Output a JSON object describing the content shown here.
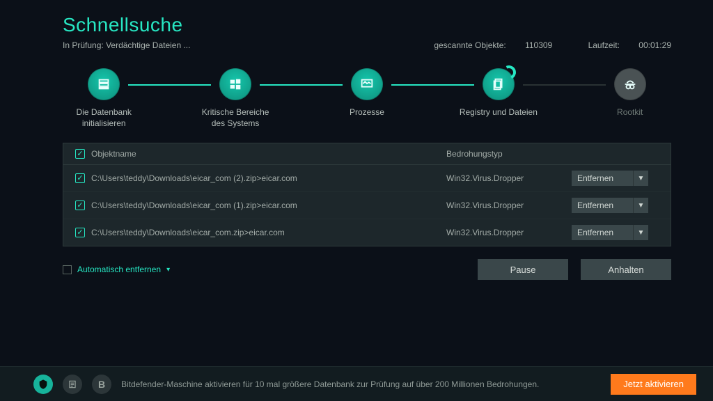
{
  "header": {
    "title": "Schnellsuche",
    "status_prefix": "In Prüfung:",
    "status_item": "Verdächtige Dateien ...",
    "scanned_label": "gescannte Objekte:",
    "scanned_value": "110309",
    "runtime_label": "Laufzeit:",
    "runtime_value": "00:01:29"
  },
  "steps": [
    {
      "label": "Die Datenbank initialisieren",
      "state": "done"
    },
    {
      "label": "Kritische Bereiche des Systems",
      "state": "done"
    },
    {
      "label": "Prozesse",
      "state": "done"
    },
    {
      "label": "Registry und Dateien",
      "state": "active"
    },
    {
      "label": "Rootkit",
      "state": "pending"
    }
  ],
  "table": {
    "header_check": true,
    "col_name": "Objektname",
    "col_type": "Bedrohungstyp",
    "rows": [
      {
        "checked": true,
        "name": "C:\\Users\\teddy\\Downloads\\eicar_com (2).zip>eicar.com",
        "type": "Win32.Virus.Dropper",
        "action": "Entfernen"
      },
      {
        "checked": true,
        "name": "C:\\Users\\teddy\\Downloads\\eicar_com (1).zip>eicar.com",
        "type": "Win32.Virus.Dropper",
        "action": "Entfernen"
      },
      {
        "checked": true,
        "name": "C:\\Users\\teddy\\Downloads\\eicar_com.zip>eicar.com",
        "type": "Win32.Virus.Dropper",
        "action": "Entfernen"
      }
    ]
  },
  "controls": {
    "auto_remove": "Automatisch entfernen",
    "pause": "Pause",
    "stop": "Anhalten"
  },
  "footer": {
    "text": "Bitdefender-Maschine aktivieren für 10 mal größere Datenbank zur Prüfung auf über 200 Millionen Bedrohungen.",
    "cta": "Jetzt aktivieren"
  }
}
